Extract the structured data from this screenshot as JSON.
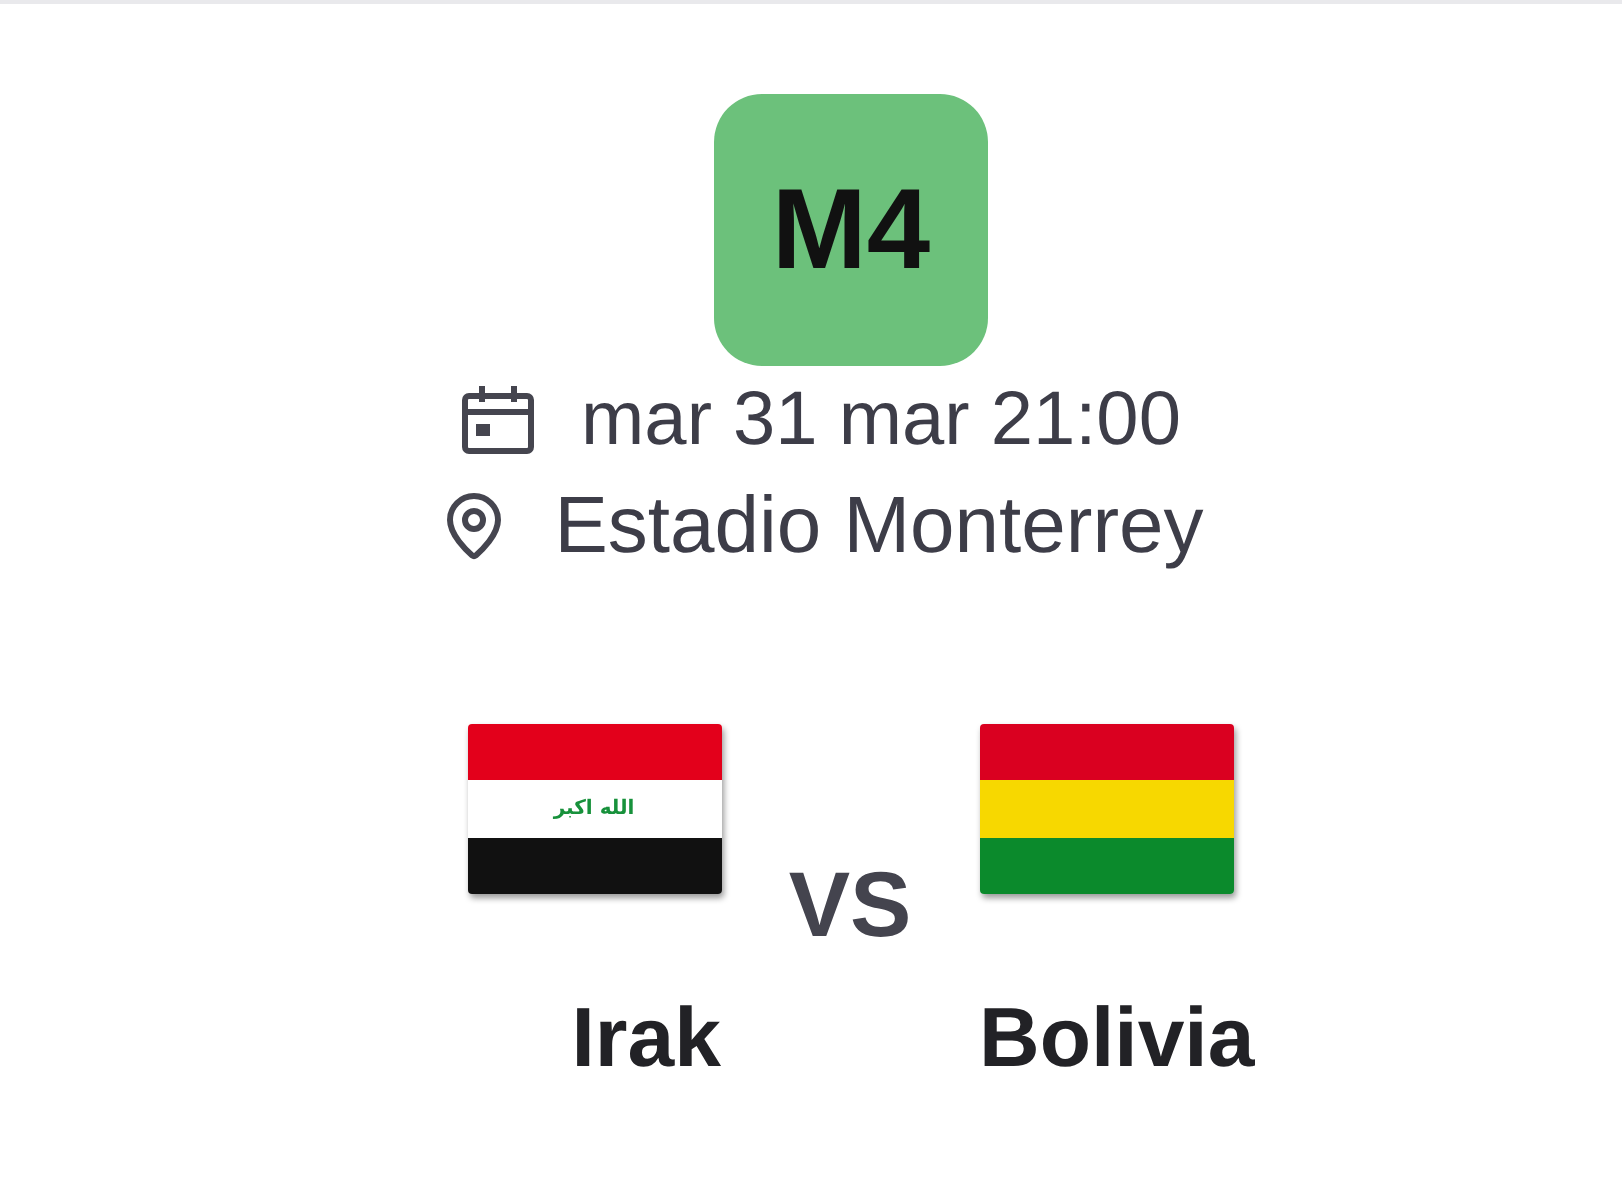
{
  "match": {
    "code": "M4",
    "date": "mar 31 mar 21:00",
    "venue": "Estadio Monterrey"
  },
  "versus": "VS",
  "teams": [
    {
      "name": "Irak",
      "flag": {
        "stripes": [
          {
            "color": "#e3001b"
          },
          {
            "color": "#ffffff"
          },
          {
            "color": "#111111"
          }
        ],
        "emblem_text": "الله اكبر"
      }
    },
    {
      "name": "Bolivia",
      "flag": {
        "stripes": [
          {
            "color": "#da0020"
          },
          {
            "color": "#f7d800"
          },
          {
            "color": "#0b8a2c"
          }
        ]
      }
    }
  ]
}
